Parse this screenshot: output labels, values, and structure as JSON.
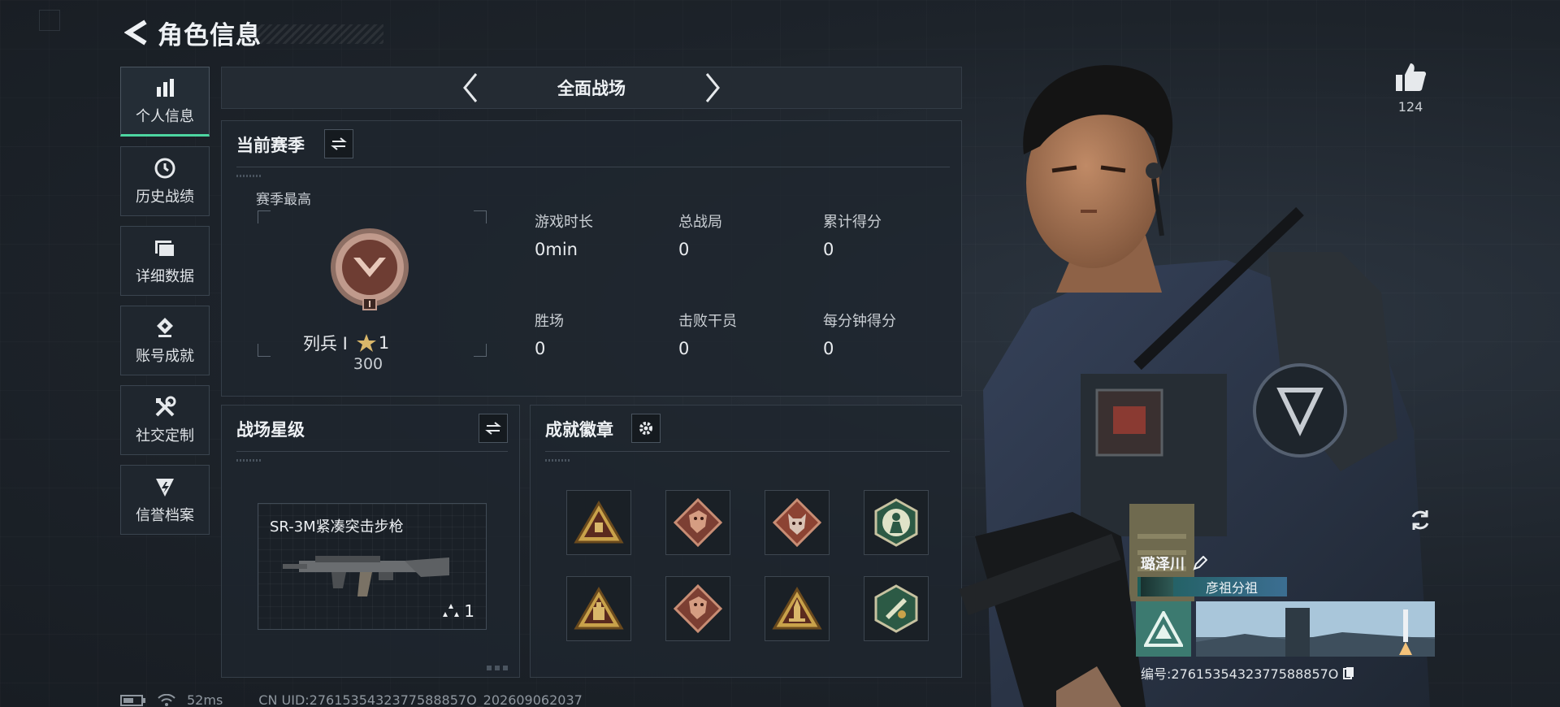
{
  "header": {
    "title": "角色信息"
  },
  "sidebar": {
    "items": [
      {
        "label": "个人信息",
        "icon": "bar-chart-icon",
        "active": true
      },
      {
        "label": "历史战绩",
        "icon": "clock-icon"
      },
      {
        "label": "详细数据",
        "icon": "folder-icon"
      },
      {
        "label": "账号成就",
        "icon": "achievement-icon"
      },
      {
        "label": "社交定制",
        "icon": "tools-icon"
      },
      {
        "label": "信誉档案",
        "icon": "credit-icon"
      }
    ]
  },
  "mode_tab": {
    "title": "全面战场"
  },
  "season": {
    "title": "当前赛季",
    "subtitle": "赛季最高",
    "rank_name": "列兵 Ⅰ",
    "rank_stars": "1",
    "rank_points": "300",
    "stats": [
      {
        "label": "游戏时长",
        "value": "0min"
      },
      {
        "label": "总战局",
        "value": "0"
      },
      {
        "label": "累计得分",
        "value": "0"
      },
      {
        "label": "胜场",
        "value": "0"
      },
      {
        "label": "击败干员",
        "value": "0"
      },
      {
        "label": "每分钟得分",
        "value": "0"
      }
    ]
  },
  "star_level": {
    "title": "战场星级",
    "weapon_name": "SR-3M紧凑突击步枪",
    "weapon_stars": "1"
  },
  "badges": {
    "title": "成就徽章",
    "items": [
      "triangle-badge-icon",
      "dragon-badge-icon",
      "wolf-badge-icon",
      "hex-soldier-badge-icon",
      "triangle-ammo-badge-icon",
      "dragon-badge-icon",
      "triangle-missile-badge-icon",
      "hex-gun-badge-icon"
    ]
  },
  "profile": {
    "likes": "124",
    "name": "璐泽川",
    "title_tag": "彦祖分祖",
    "uid_label": "编号:2761535432377588857O"
  },
  "status": {
    "ping": "52ms",
    "uid": "CN UID:2761535432377588857O_202609062037"
  },
  "colors": {
    "accent": "#4dd6a1",
    "bg": "#1b2128"
  }
}
